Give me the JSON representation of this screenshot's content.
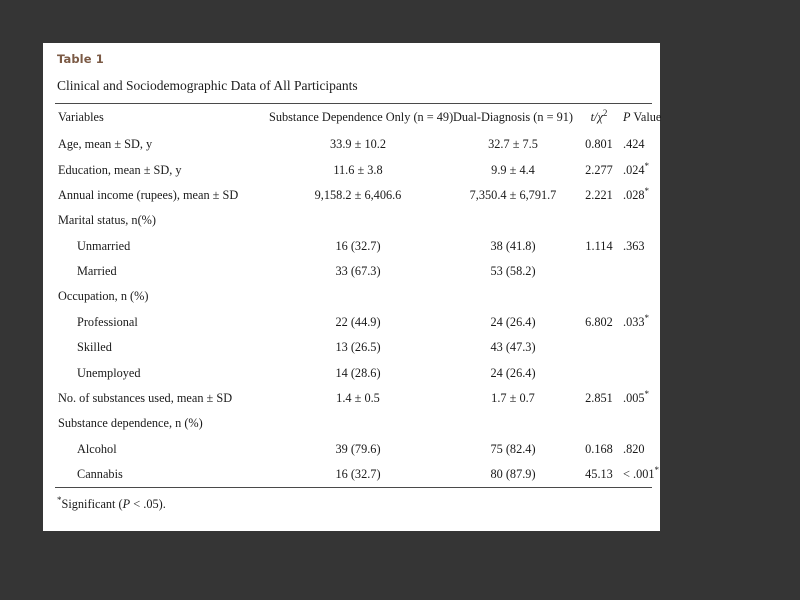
{
  "panel": {
    "table_label": "Table 1",
    "caption": "Clinical and Sociodemographic Data of All Participants"
  },
  "colors": {
    "background": "#353535",
    "paper": "#ffffff",
    "table_label": "#7b5a45",
    "text": "#1a1a1a",
    "rule": "#4a4a4a"
  },
  "table": {
    "headers": {
      "variables": "Variables",
      "group1": "Substance Dependence Only (n = 49)",
      "group2": "Dual-Diagnosis (n = 91)",
      "stat": "t/χ",
      "stat_sup": "2",
      "pvalue_italic": "P",
      "pvalue_rest": " Value"
    },
    "rows": [
      {
        "variable": "Age, mean ± SD, y",
        "indent": false,
        "group1": "33.9 ± 10.2",
        "group2": "32.7 ± 7.5",
        "stat": "0.801",
        "pvalue": ".424",
        "significant": false
      },
      {
        "variable": "Education, mean ± SD, y",
        "indent": false,
        "group1": "11.6 ± 3.8",
        "group2": "9.9 ± 4.4",
        "stat": "2.277",
        "pvalue": ".024",
        "significant": true
      },
      {
        "variable": "Annual income (rupees), mean ± SD",
        "indent": false,
        "group1": "9,158.2 ± 6,406.6",
        "group2": "7,350.4 ± 6,791.7",
        "stat": "2.221",
        "pvalue": ".028",
        "significant": true
      },
      {
        "variable": "Marital status, n(%)",
        "indent": false,
        "group1": "",
        "group2": "",
        "stat": "",
        "pvalue": "",
        "significant": false
      },
      {
        "variable": "Unmarried",
        "indent": true,
        "group1": "16 (32.7)",
        "group2": "38 (41.8)",
        "stat": "1.114",
        "pvalue": ".363",
        "significant": false
      },
      {
        "variable": "Married",
        "indent": true,
        "group1": "33 (67.3)",
        "group2": "53 (58.2)",
        "stat": "",
        "pvalue": "",
        "significant": false
      },
      {
        "variable": "Occupation, n (%)",
        "indent": false,
        "group1": "",
        "group2": "",
        "stat": "",
        "pvalue": "",
        "significant": false
      },
      {
        "variable": "Professional",
        "indent": true,
        "group1": "22 (44.9)",
        "group2": "24 (26.4)",
        "stat": "6.802",
        "pvalue": ".033",
        "significant": true
      },
      {
        "variable": "Skilled",
        "indent": true,
        "group1": "13 (26.5)",
        "group2": "43 (47.3)",
        "stat": "",
        "pvalue": "",
        "significant": false
      },
      {
        "variable": "Unemployed",
        "indent": true,
        "group1": "14 (28.6)",
        "group2": "24 (26.4)",
        "stat": "",
        "pvalue": "",
        "significant": false
      },
      {
        "variable": "No. of substances used, mean ± SD",
        "indent": false,
        "group1": "1.4 ± 0.5",
        "group2": "1.7 ± 0.7",
        "stat": "2.851",
        "pvalue": ".005",
        "significant": true
      },
      {
        "variable": "Substance dependence, n (%)",
        "indent": false,
        "group1": "",
        "group2": "",
        "stat": "",
        "pvalue": "",
        "significant": false
      },
      {
        "variable": "Alcohol",
        "indent": true,
        "group1": "39 (79.6)",
        "group2": "75 (82.4)",
        "stat": "0.168",
        "pvalue": ".820",
        "significant": false
      },
      {
        "variable": "Cannabis",
        "indent": true,
        "group1": "16 (32.7)",
        "group2": "80 (87.9)",
        "stat": "45.13",
        "pvalue": "< .001",
        "significant": true
      }
    ],
    "footnote": {
      "marker": "*",
      "text_before": "Significant (",
      "text_italic": "P",
      "text_after": " < .05)."
    }
  }
}
